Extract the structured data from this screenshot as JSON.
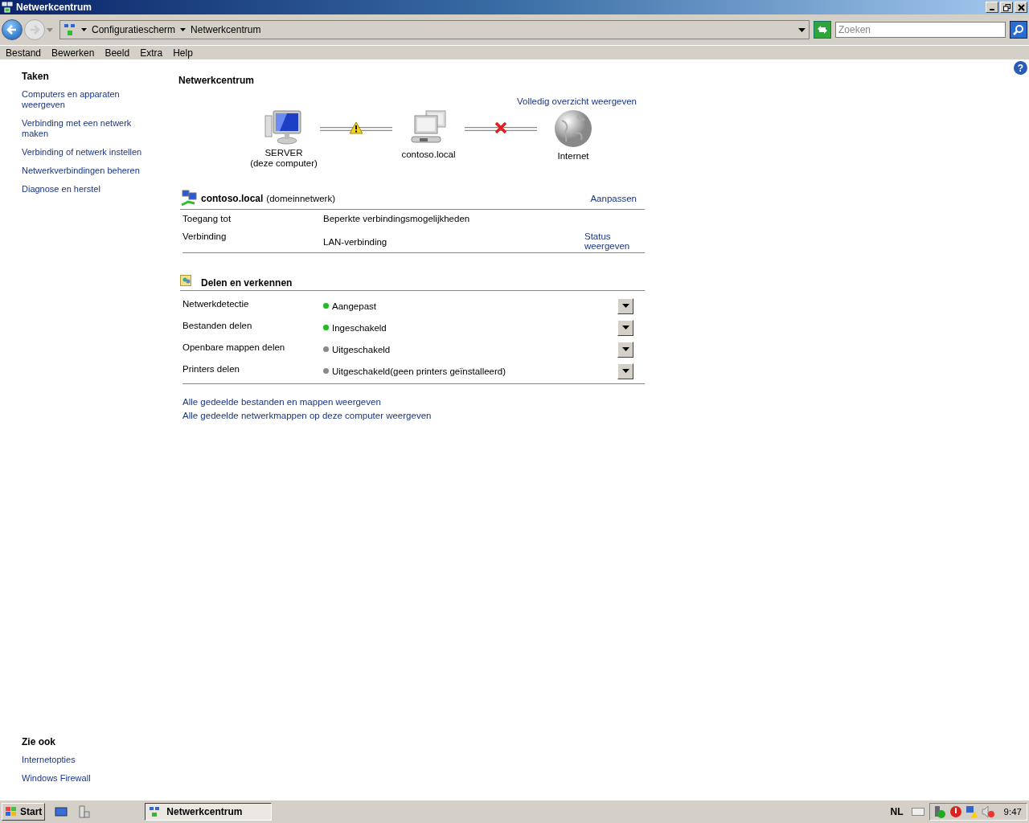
{
  "window": {
    "title": "Netwerkcentrum"
  },
  "address": {
    "breadcrumbs": [
      "Configuratiescherm",
      "Netwerkcentrum"
    ],
    "search": {
      "placeholder": "Zoeken"
    }
  },
  "help": "?",
  "menu": [
    "Bestand",
    "Bewerken",
    "Beeld",
    "Extra",
    "Help"
  ],
  "sidebar": {
    "tasks_title": "Taken",
    "tasks": [
      "Computers en apparaten weergeven",
      "Verbinding met een netwerk maken",
      "Verbinding of netwerk instellen",
      "Netwerkverbindingen beheren",
      "Diagnose en herstel"
    ],
    "see_also_title": "Zie ook",
    "see_also": [
      "Internetopties",
      "Windows Firewall"
    ]
  },
  "main": {
    "title": "Netwerkcentrum",
    "full_map_link": "Volledig overzicht weergeven",
    "map": [
      {
        "kind": "computer",
        "label": "SERVER",
        "sublabel": "(deze computer)"
      },
      {
        "kind": "warning"
      },
      {
        "kind": "network",
        "label": "contoso.local"
      },
      {
        "kind": "error"
      },
      {
        "kind": "internet",
        "label": "Internet"
      }
    ],
    "network": {
      "name": "contoso.local",
      "type": "(domeinnetwerk)",
      "customize": "Aanpassen",
      "rows": [
        {
          "label": "Toegang tot",
          "value": "Beperkte verbindingsmogelijkheden"
        },
        {
          "label": "Verbinding",
          "value": "LAN-verbinding",
          "link": "Status weergeven"
        }
      ]
    },
    "sharing": {
      "title": "Delen en verkennen",
      "rows": [
        {
          "label": "Netwerkdetectie",
          "status": "Aangepast",
          "on": true
        },
        {
          "label": "Bestanden delen",
          "status": "Ingeschakeld",
          "on": true
        },
        {
          "label": "Openbare mappen delen",
          "status": "Uitgeschakeld",
          "on": false
        },
        {
          "label": "Printers delen",
          "status": "Uitgeschakeld",
          "note": "(geen printers geïnstalleerd)",
          "on": false
        }
      ]
    },
    "links": [
      "Alle gedeelde bestanden en mappen weergeven",
      "Alle gedeelde netwerkmappen op deze computer weergeven"
    ]
  },
  "taskbar": {
    "start": "Start",
    "windows": [
      {
        "title": "Netwerkcentrum",
        "selected": true
      }
    ],
    "language": "NL",
    "clock": "9:47"
  }
}
